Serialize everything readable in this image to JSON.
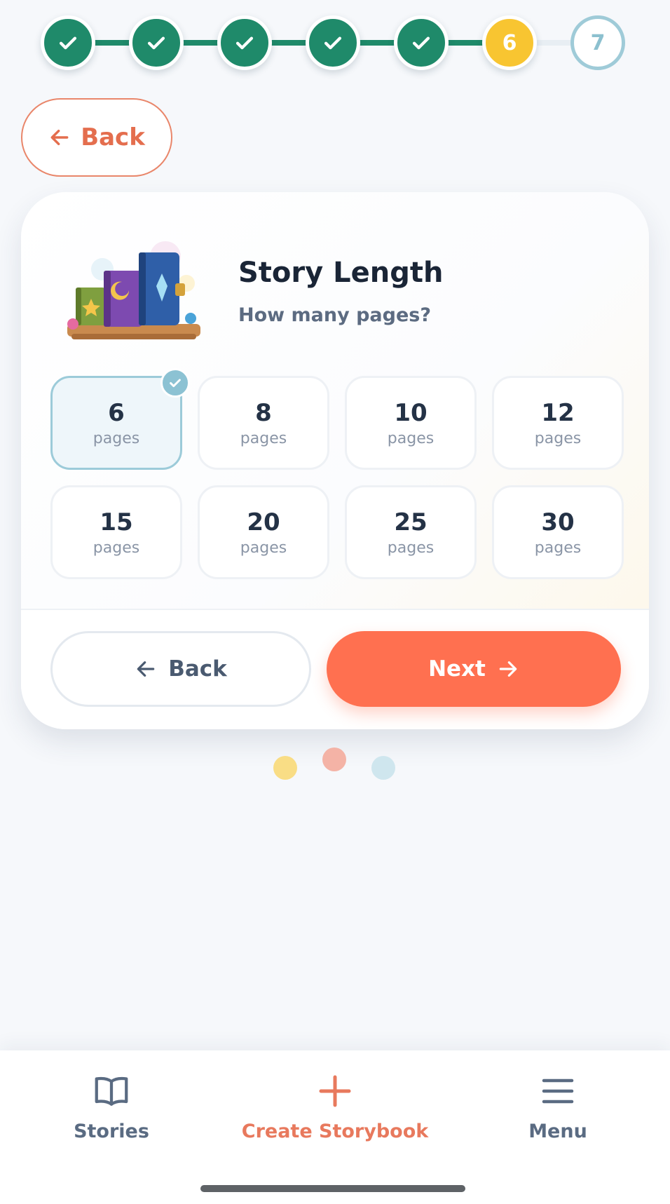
{
  "stepper": {
    "steps": [
      {
        "state": "done",
        "label": ""
      },
      {
        "state": "done",
        "label": ""
      },
      {
        "state": "done",
        "label": ""
      },
      {
        "state": "done",
        "label": ""
      },
      {
        "state": "done",
        "label": ""
      },
      {
        "state": "current",
        "label": "6"
      },
      {
        "state": "todo",
        "label": "7"
      }
    ],
    "colors": {
      "done": "#1f8a6a",
      "current": "#f8c531",
      "todo": "#9fcbd8"
    }
  },
  "top_back": {
    "label": "Back",
    "icon": "arrow-left-icon",
    "color": "#e46e4e"
  },
  "card": {
    "title": "Story Length",
    "subtitle": "How many pages?",
    "illustration": "books-illustration",
    "options": [
      {
        "value": "6",
        "unit": "pages",
        "selected": true
      },
      {
        "value": "8",
        "unit": "pages",
        "selected": false
      },
      {
        "value": "10",
        "unit": "pages",
        "selected": false
      },
      {
        "value": "12",
        "unit": "pages",
        "selected": false
      },
      {
        "value": "15",
        "unit": "pages",
        "selected": false
      },
      {
        "value": "20",
        "unit": "pages",
        "selected": false
      },
      {
        "value": "25",
        "unit": "pages",
        "selected": false
      },
      {
        "value": "30",
        "unit": "pages",
        "selected": false
      }
    ],
    "back_label": "Back",
    "next_label": "Next",
    "accent": "#ff7050"
  },
  "decor_dots": {
    "colors": [
      "#f9dd85",
      "#f4b3a6",
      "#cfe6ee"
    ]
  },
  "nav": {
    "stories": {
      "label": "Stories",
      "icon": "book-icon"
    },
    "create": {
      "label": "Create Storybook",
      "icon": "plus-icon"
    },
    "menu": {
      "label": "Menu",
      "icon": "hamburger-menu-icon"
    }
  }
}
